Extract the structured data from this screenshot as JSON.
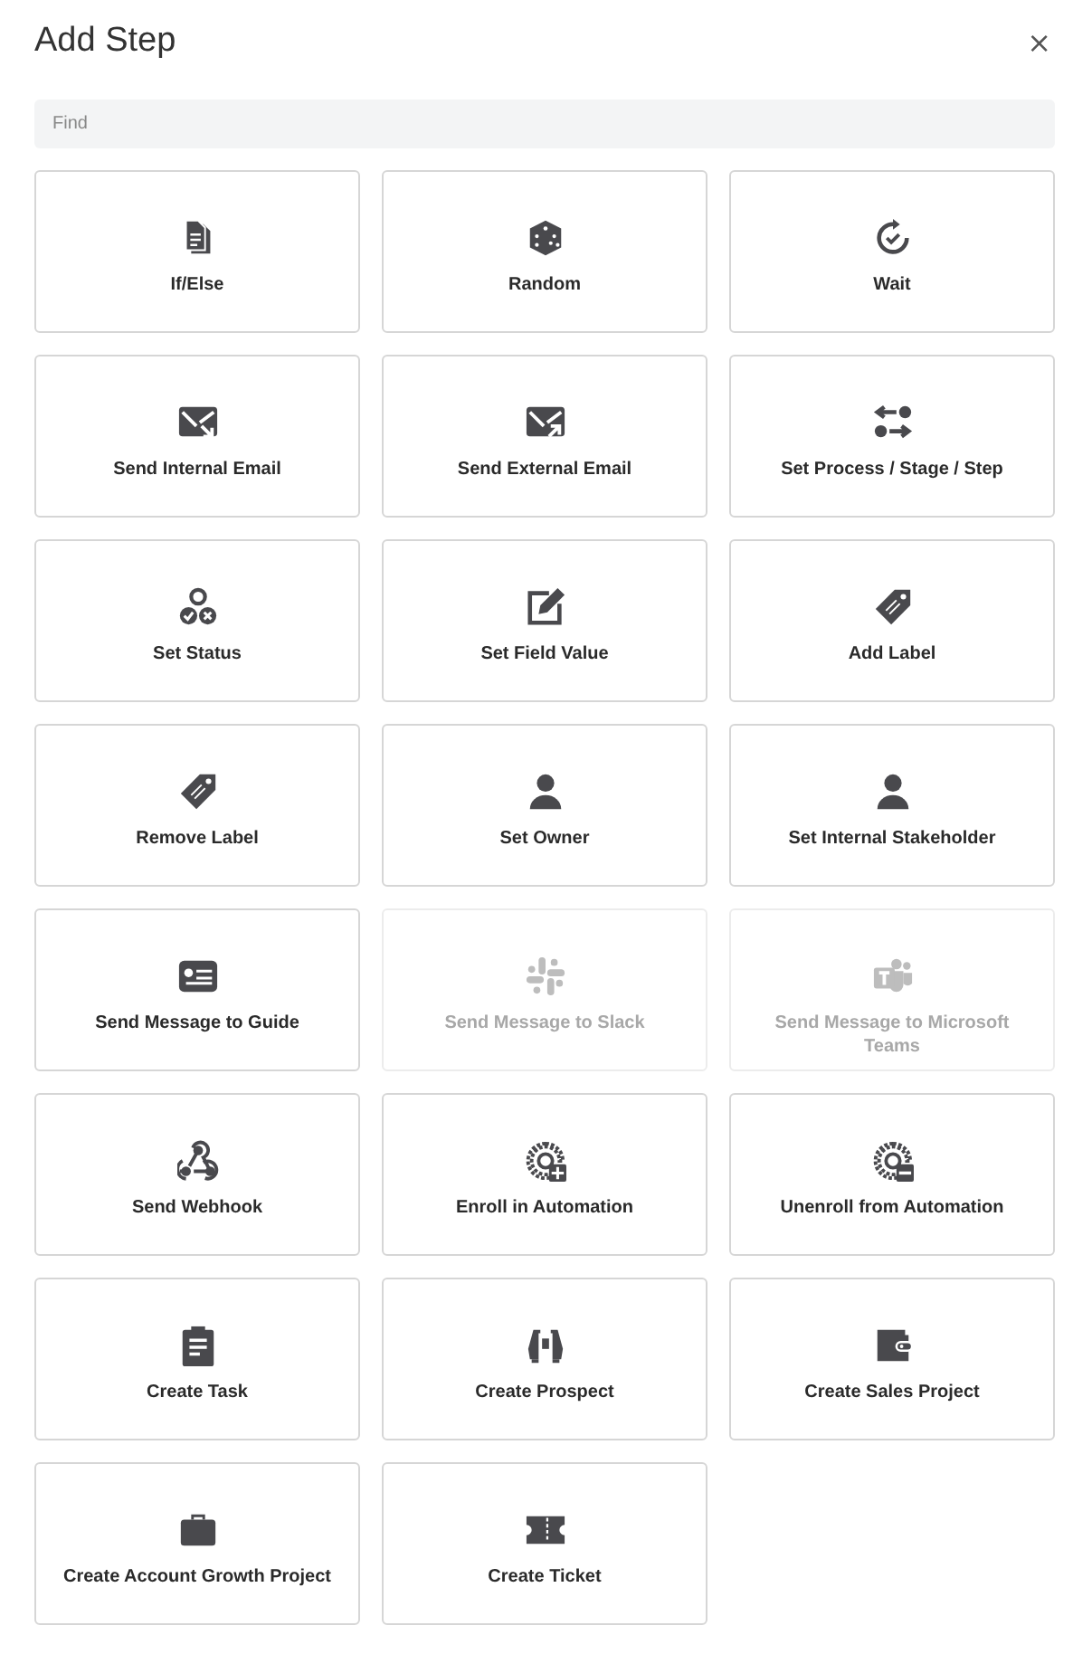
{
  "dialog": {
    "title": "Add Step",
    "close": "×"
  },
  "search": {
    "placeholder": "Find"
  },
  "steps": [
    {
      "label": "If/Else",
      "kind": "documents",
      "disabled": false
    },
    {
      "label": "Random",
      "kind": "dice",
      "disabled": false
    },
    {
      "label": "Wait",
      "kind": "refresh-check",
      "disabled": false
    },
    {
      "label": "Send Internal Email",
      "kind": "envelope-in",
      "disabled": false
    },
    {
      "label": "Send External Email",
      "kind": "envelope-out",
      "disabled": false
    },
    {
      "label": "Set Process / Stage / Step",
      "kind": "arrows",
      "disabled": false
    },
    {
      "label": "Set Status",
      "kind": "status",
      "disabled": false
    },
    {
      "label": "Set Field Value",
      "kind": "edit",
      "disabled": false
    },
    {
      "label": "Add Label",
      "kind": "tag",
      "disabled": false
    },
    {
      "label": "Remove Label",
      "kind": "tag",
      "disabled": false
    },
    {
      "label": "Set Owner",
      "kind": "person",
      "disabled": false
    },
    {
      "label": "Set Internal Stakeholder",
      "kind": "person",
      "disabled": false
    },
    {
      "label": "Send Message to Guide",
      "kind": "card",
      "disabled": false
    },
    {
      "label": "Send Message to Slack",
      "kind": "hash",
      "disabled": true
    },
    {
      "label": "Send Message to Microsoft Teams",
      "kind": "team",
      "disabled": true
    },
    {
      "label": "Send Webhook",
      "kind": "webhook",
      "disabled": false
    },
    {
      "label": "Enroll in Automation",
      "kind": "gear-plus",
      "disabled": false
    },
    {
      "label": "Unenroll from Automation",
      "kind": "gear-minus",
      "disabled": false
    },
    {
      "label": "Create Task",
      "kind": "clipboard",
      "disabled": false
    },
    {
      "label": "Create Prospect",
      "kind": "binoculars",
      "disabled": false
    },
    {
      "label": "Create Sales Project",
      "kind": "wallet",
      "disabled": false
    },
    {
      "label": "Create Account Growth Project",
      "kind": "briefcase",
      "disabled": false
    },
    {
      "label": "Create Ticket",
      "kind": "ticket",
      "disabled": false
    }
  ]
}
